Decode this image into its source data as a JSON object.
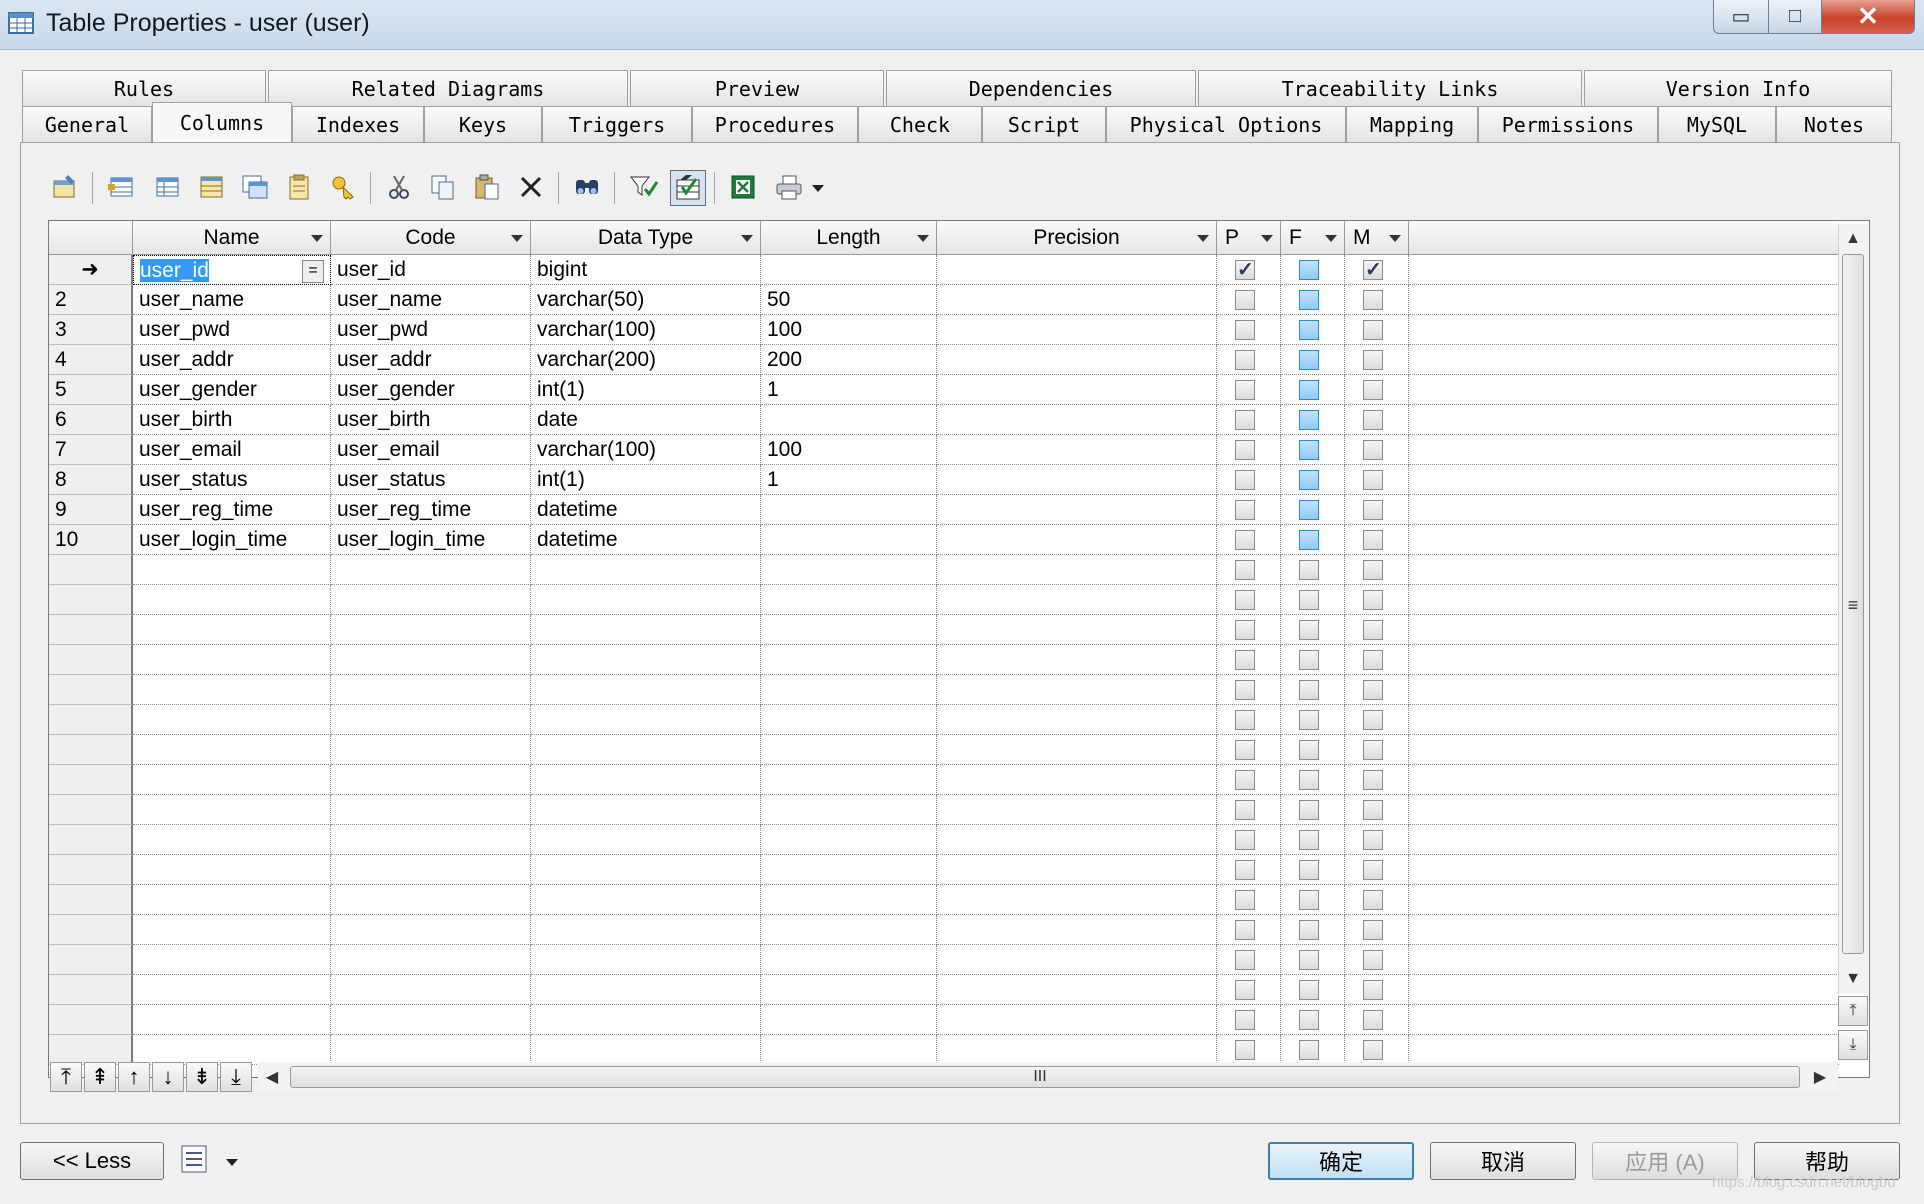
{
  "window": {
    "title": "Table Properties - user (user)",
    "minimize_glyph": "▭",
    "maximize_glyph": "□",
    "close_glyph": "✕"
  },
  "tabs_row1": [
    "Rules",
    "Related Diagrams",
    "Preview",
    "Dependencies",
    "Traceability Links",
    "Version Info"
  ],
  "tabs_row2": [
    "General",
    "Columns",
    "Indexes",
    "Keys",
    "Triggers",
    "Procedures",
    "Check",
    "Script",
    "Physical Options",
    "Mapping",
    "Permissions",
    "MySQL",
    "Notes"
  ],
  "active_tab": "Columns",
  "grid": {
    "headers": [
      "Name",
      "Code",
      "Data Type",
      "Length",
      "Precision",
      "P",
      "F",
      "M"
    ],
    "current_row_marker": "➜",
    "current_cell_button": "=",
    "rows": [
      {
        "num": "",
        "name": "user_id",
        "code": "user_id",
        "type": "bigint",
        "length": "",
        "precision": "",
        "p": true,
        "f": false,
        "m": true
      },
      {
        "num": "2",
        "name": "user_name",
        "code": "user_name",
        "type": "varchar(50)",
        "length": "50",
        "precision": "",
        "p": false,
        "f": false,
        "m": false
      },
      {
        "num": "3",
        "name": "user_pwd",
        "code": "user_pwd",
        "type": "varchar(100)",
        "length": "100",
        "precision": "",
        "p": false,
        "f": false,
        "m": false
      },
      {
        "num": "4",
        "name": "user_addr",
        "code": "user_addr",
        "type": "varchar(200)",
        "length": "200",
        "precision": "",
        "p": false,
        "f": false,
        "m": false
      },
      {
        "num": "5",
        "name": "user_gender",
        "code": "user_gender",
        "type": "int(1)",
        "length": "1",
        "precision": "",
        "p": false,
        "f": false,
        "m": false
      },
      {
        "num": "6",
        "name": "user_birth",
        "code": "user_birth",
        "type": "date",
        "length": "",
        "precision": "",
        "p": false,
        "f": false,
        "m": false
      },
      {
        "num": "7",
        "name": "user_email",
        "code": "user_email",
        "type": "varchar(100)",
        "length": "100",
        "precision": "",
        "p": false,
        "f": false,
        "m": false
      },
      {
        "num": "8",
        "name": "user_status",
        "code": "user_status",
        "type": "int(1)",
        "length": "1",
        "precision": "",
        "p": false,
        "f": false,
        "m": false
      },
      {
        "num": "9",
        "name": "user_reg_time",
        "code": "user_reg_time",
        "type": "datetime",
        "length": "",
        "precision": "",
        "p": false,
        "f": false,
        "m": false
      },
      {
        "num": "10",
        "name": "user_login_time",
        "code": "user_login_time",
        "type": "datetime",
        "length": "",
        "precision": "",
        "p": false,
        "f": false,
        "m": false
      }
    ],
    "empty_rows": 17,
    "hscroll_grip": "III",
    "vscroll_grip": "≡"
  },
  "nav_buttons": [
    "⤒",
    "⇞",
    "↑",
    "↓",
    "⇟",
    "⤓"
  ],
  "buttons": {
    "less": "<< Less",
    "ok": "确定",
    "cancel": "取消",
    "apply": "应用 (A)",
    "help": "帮助"
  },
  "watermark": "https://blog.csdn.net/blogbu",
  "colors": {
    "title_bar": "#c9d8eb",
    "close_red": "#c7432b",
    "foreign_checkbox_blue": "#8fcaf7",
    "selection_blue": "#3399ff"
  }
}
